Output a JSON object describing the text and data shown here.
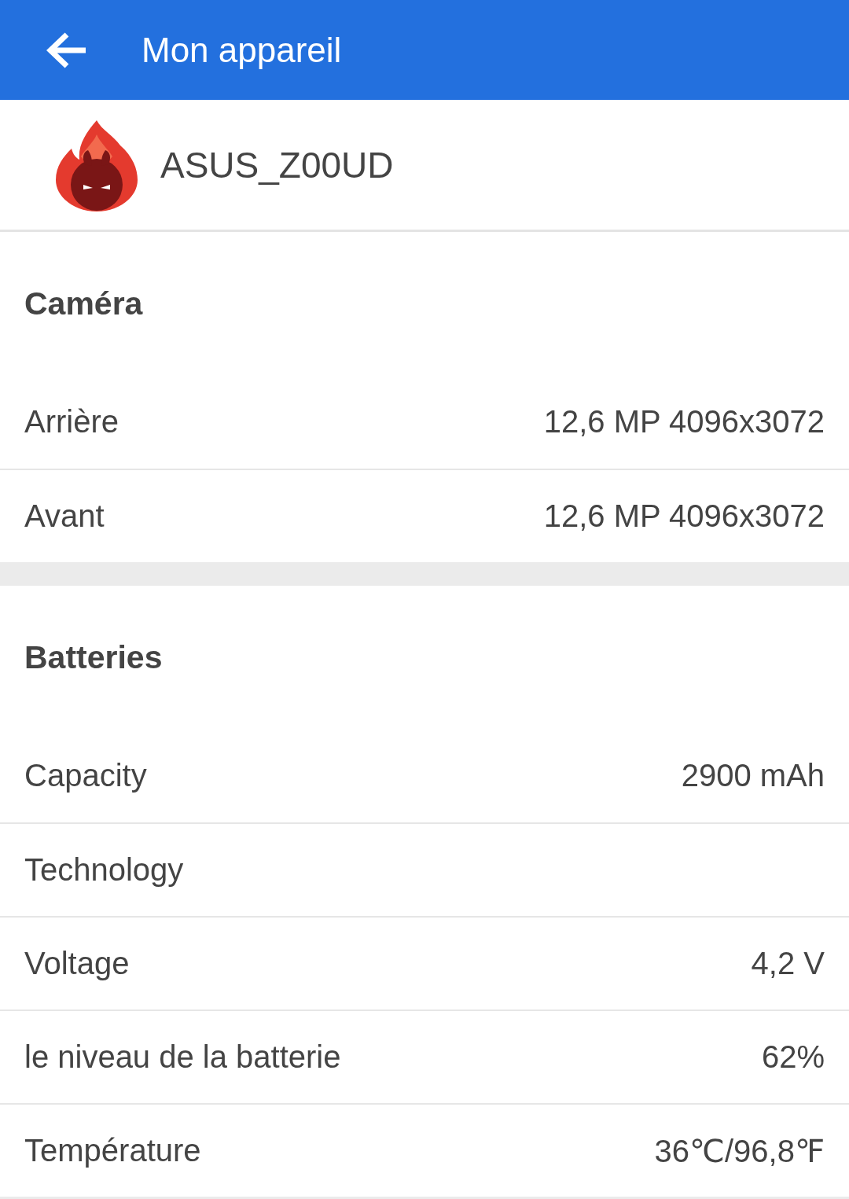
{
  "app_bar": {
    "title": "Mon appareil"
  },
  "device": {
    "name": "ASUS_Z00UD"
  },
  "sections": [
    {
      "title": "Caméra",
      "rows": [
        {
          "label": "Arrière",
          "value": "12,6 MP 4096x3072"
        },
        {
          "label": "Avant",
          "value": "12,6 MP 4096x3072"
        }
      ]
    },
    {
      "title": "Batteries",
      "rows": [
        {
          "label": "Capacity",
          "value": "2900 mAh"
        },
        {
          "label": "Technology"
        },
        {
          "label": "Voltage",
          "value": "4,2 V"
        },
        {
          "label": "le niveau de la batterie",
          "value": "62%"
        },
        {
          "label": "Température",
          "value": "36℃/96,8℉"
        }
      ]
    }
  ]
}
